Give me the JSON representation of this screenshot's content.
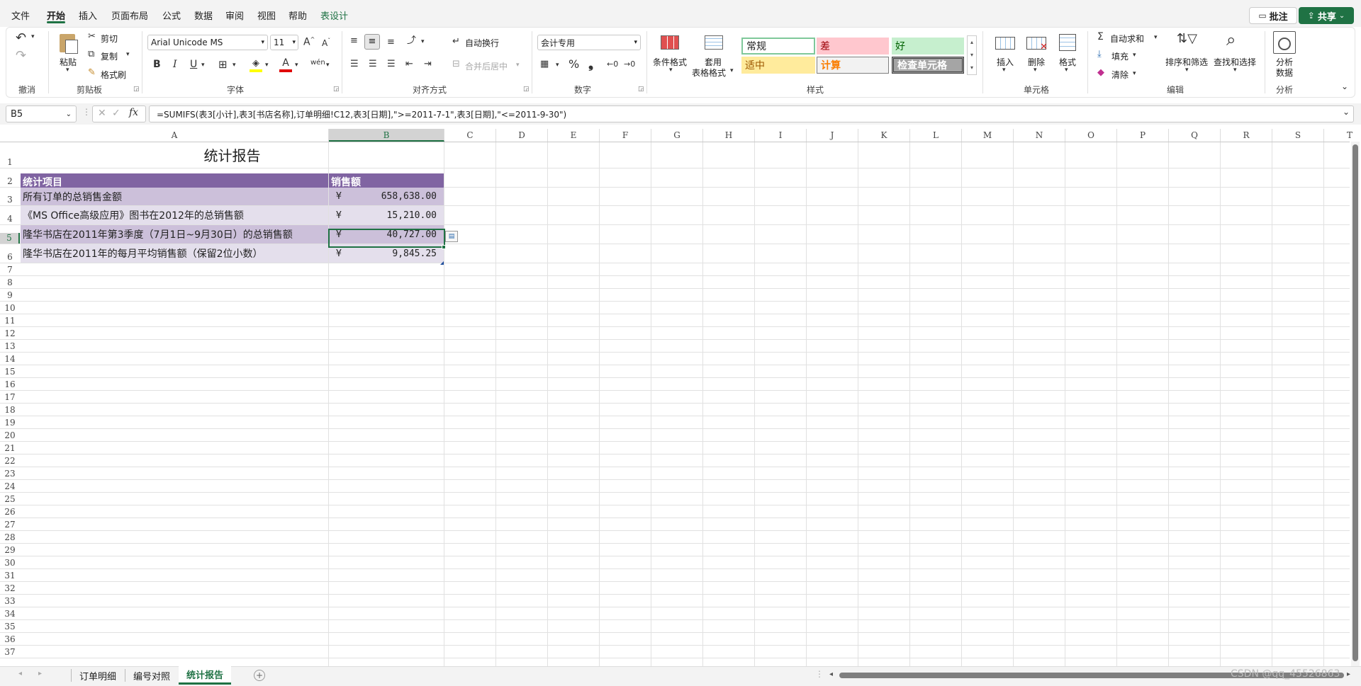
{
  "menu": [
    "文件",
    "开始",
    "插入",
    "页面布局",
    "公式",
    "数据",
    "审阅",
    "视图",
    "帮助",
    "表设计"
  ],
  "top_buttons": {
    "comment": "批注",
    "share": "共享"
  },
  "ribbon": {
    "undo_group": "撤消",
    "clipboard": {
      "paste": "粘贴",
      "cut": "剪切",
      "copy": "复制",
      "format_painter": "格式刷",
      "group": "剪贴板"
    },
    "font": {
      "name": "Arial Unicode MS",
      "size": "11",
      "bold": "B",
      "italic": "I",
      "underline": "U",
      "group": "字体"
    },
    "alignment": {
      "wrap": "自动换行",
      "merge": "合并后居中",
      "group": "对齐方式"
    },
    "number": {
      "format": "会计专用",
      "percent": "%",
      "group": "数字"
    },
    "styles": {
      "cond_format": "条件格式",
      "table_format_1": "套用",
      "table_format_2": "表格格式",
      "normal": "常规",
      "bad": "差",
      "good": "好",
      "neutral": "适中",
      "calc": "计算",
      "check": "检查单元格",
      "group": "样式"
    },
    "cells": {
      "insert": "插入",
      "delete": "删除",
      "format": "格式",
      "group": "单元格"
    },
    "editing": {
      "autosum": "自动求和",
      "fill": "填充",
      "clear": "清除",
      "sort": "排序和筛选",
      "find": "查找和选择",
      "group": "编辑"
    },
    "analysis": {
      "analyze_1": "分析",
      "analyze_2": "数据",
      "group": "分析"
    }
  },
  "formula_bar": {
    "name_box": "B5",
    "fx": "fx",
    "formula": "=SUMIFS(表3[小计],表3[书店名称],订单明细!C12,表3[日期],\">=2011-7-1\",表3[日期],\"<=2011-9-30\")"
  },
  "columns": [
    "A",
    "B",
    "C",
    "D",
    "E",
    "F",
    "G",
    "H",
    "I",
    "J",
    "K",
    "L",
    "M",
    "N",
    "O",
    "P",
    "Q",
    "R",
    "S",
    "T"
  ],
  "rows": [
    "1",
    "2",
    "3",
    "4",
    "5",
    "6",
    "7",
    "8",
    "9",
    "10",
    "11",
    "12",
    "13",
    "14",
    "15",
    "16",
    "17",
    "18",
    "19",
    "20",
    "21",
    "22",
    "23",
    "24",
    "25",
    "26",
    "27",
    "28",
    "29",
    "30",
    "31",
    "32",
    "33",
    "34",
    "35",
    "36",
    "37"
  ],
  "sheet": {
    "title": "统计报告",
    "header": {
      "item": "统计项目",
      "amount": "销售额"
    },
    "currency": "¥",
    "data_rows": [
      {
        "item": "所有订单的总销售金额",
        "amount": "658,638.00"
      },
      {
        "item": "《MS Office高级应用》图书在2012年的总销售额",
        "amount": "15,210.00"
      },
      {
        "item": "隆华书店在2011年第3季度（7月1日~9月30日）的总销售额",
        "amount": "40,727.00"
      },
      {
        "item": "隆华书店在2011年的每月平均销售额（保留2位小数）",
        "amount": "9,845.25"
      }
    ]
  },
  "tabs": [
    "订单明细",
    "编号对照",
    "统计报告"
  ],
  "active_tab": "统计报告",
  "watermark": "CSDN @qq_45526863",
  "colors": {
    "accent": "#1f7244",
    "header_purple": "#8064a2",
    "row_dark": "#ccc0da",
    "row_light": "#e4dfec"
  }
}
